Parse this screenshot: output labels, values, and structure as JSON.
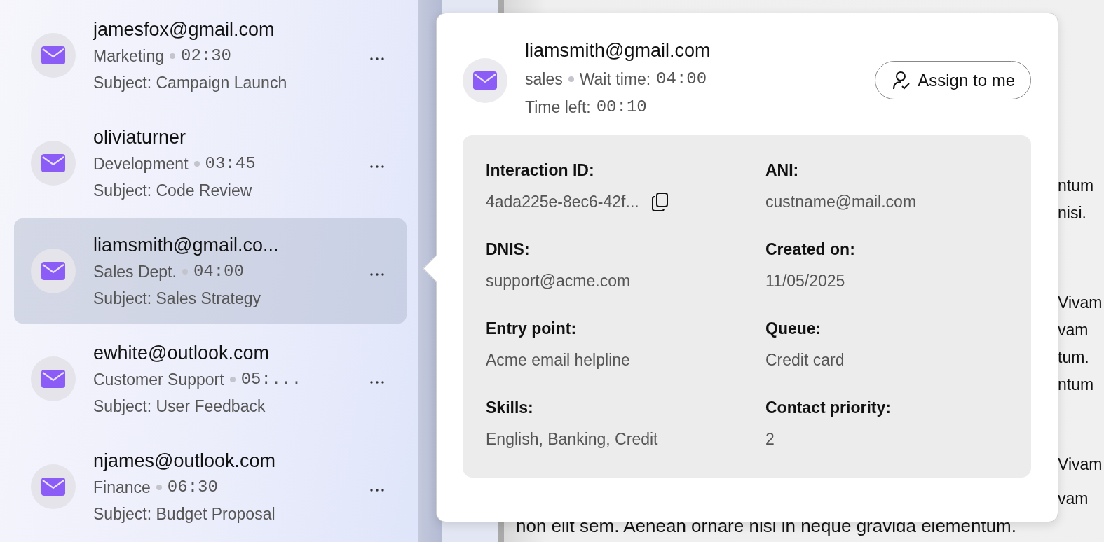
{
  "conversations": [
    {
      "name": "jamesfox@gmail.com",
      "department": "Marketing",
      "time": "02:30",
      "subject": "Subject: Campaign Launch",
      "selected": false
    },
    {
      "name": "oliviaturner",
      "department": "Development",
      "time": "03:45",
      "subject": "Subject: Code Review",
      "selected": false
    },
    {
      "name": "liamsmith@gmail.co...",
      "department": "Sales Dept.",
      "time": "04:00",
      "subject": "Subject: Sales Strategy",
      "selected": true
    },
    {
      "name": "ewhite@outlook.com",
      "department": "Customer Support",
      "time": "05:...",
      "subject": "Subject: User Feedback",
      "selected": false
    },
    {
      "name": "njames@outlook.com",
      "department": "Finance",
      "time": "06:30",
      "subject": "Subject: Budget Proposal",
      "selected": false
    }
  ],
  "popup": {
    "title": "liamsmith@gmail.com",
    "queue": "sales",
    "wait_label": "Wait time:",
    "wait_time": "04:00",
    "time_left_label": "Time left:",
    "time_left": "00:10",
    "assign_button": "Assign to me",
    "details": [
      {
        "label": "Interaction ID:",
        "value": "4ada225e-8ec6-42f...",
        "kind": "copyable"
      },
      {
        "label": "ANI:",
        "value": "custname@mail.com",
        "kind": "text"
      },
      {
        "label": "DNIS:",
        "value": "support@acme.com",
        "kind": "text"
      },
      {
        "label": "Created on:",
        "value": "11/05/2025",
        "kind": "text"
      },
      {
        "label": "Entry point:",
        "value": "Acme email helpline",
        "kind": "text"
      },
      {
        "label": "Queue:",
        "value": "Credit card",
        "kind": "text"
      },
      {
        "label": "Skills:",
        "value": "English, Banking, Credit",
        "kind": "text"
      },
      {
        "label": "Contact priority:",
        "value": "2",
        "kind": "text"
      }
    ]
  },
  "document": {
    "lines": [
      {
        "text": "ntum",
        "kind": "fragment"
      },
      {
        "text": "nisi.",
        "kind": "fragment"
      },
      {
        "text": "Vivam",
        "kind": "fragment"
      },
      {
        "text": "vam",
        "kind": "fragment"
      },
      {
        "text": "tum.",
        "kind": "fragment"
      },
      {
        "text": "ntum",
        "kind": "fragment"
      },
      {
        "text": "Vivam",
        "kind": "fragment"
      },
      {
        "text": "vam",
        "kind": "fragment"
      },
      {
        "text": "non elit sem. Aenean ornare nisi in neque gravida elementum.",
        "kind": "line"
      }
    ]
  }
}
